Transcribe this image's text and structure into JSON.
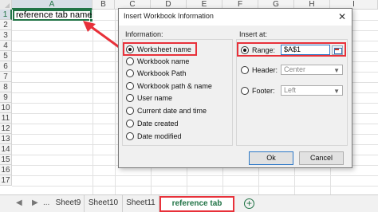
{
  "spreadsheet": {
    "columns": [
      "A",
      "B",
      "C",
      "D",
      "E",
      "F",
      "G",
      "H",
      "I"
    ],
    "rows": [
      "1",
      "2",
      "3",
      "4",
      "5",
      "6",
      "7",
      "8",
      "9",
      "10",
      "11",
      "12",
      "13",
      "14",
      "15",
      "16",
      "17"
    ],
    "cell_a1_value": "reference tab name"
  },
  "sheet_tabs": {
    "ellipsis": "...",
    "tabs": [
      "Sheet9",
      "Sheet10",
      "Sheet11",
      "reference tab name"
    ],
    "active_index": 3
  },
  "dialog": {
    "title": "Insert Workbook Information",
    "close_glyph": "✕",
    "information": {
      "label": "Information:",
      "options": [
        "Worksheet name",
        "Workbook name",
        "Workbook Path",
        "Workbook path & name",
        "User name",
        "Current date and time",
        "Date created",
        "Date modified"
      ],
      "selected_index": 0
    },
    "insert_at": {
      "label": "Insert at:",
      "range_label": "Range:",
      "range_value": "$A$1",
      "header_label": "Header:",
      "header_value": "Center",
      "footer_label": "Footer:",
      "footer_value": "Left",
      "selected": "Range"
    },
    "ok_label": "Ok",
    "cancel_label": "Cancel"
  },
  "colors": {
    "excel_green": "#217346",
    "highlight_red": "#e8313a"
  }
}
